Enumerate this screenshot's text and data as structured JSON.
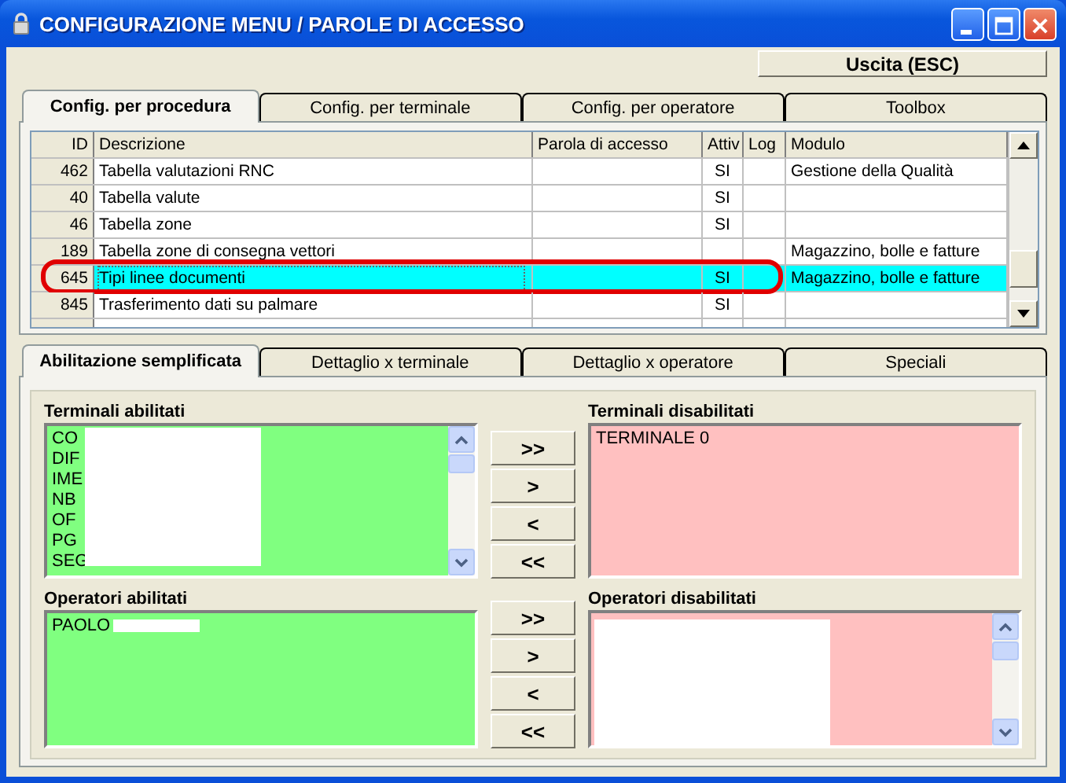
{
  "window": {
    "title": "CONFIGURAZIONE MENU / PAROLE DI ACCESSO"
  },
  "exit_button": "Uscita (ESC)",
  "tabs": [
    {
      "label": "Config. per procedura",
      "selected": true
    },
    {
      "label": "Config. per terminale",
      "selected": false
    },
    {
      "label": "Config. per operatore",
      "selected": false
    },
    {
      "label": "Toolbox",
      "selected": false
    }
  ],
  "table": {
    "columns": [
      "ID",
      "Descrizione",
      "Parola di accesso",
      "Attiv",
      "Log",
      "Modulo"
    ],
    "rows": [
      {
        "id": "462",
        "descrizione": "Tabella valutazioni RNC",
        "attiv": "SI",
        "modulo": "Gestione della Qualità",
        "selected": false
      },
      {
        "id": "40",
        "descrizione": "Tabella valute",
        "attiv": "SI",
        "selected": false
      },
      {
        "id": "46",
        "descrizione": "Tabella zone",
        "attiv": "SI",
        "selected": false
      },
      {
        "id": "189",
        "descrizione": "Tabella zone di consegna vettori",
        "modulo": "Magazzino, bolle e fatture",
        "selected": false
      },
      {
        "id": "645",
        "descrizione": "Tipi linee documenti",
        "attiv": "SI",
        "modulo": "Magazzino, bolle e fatture",
        "selected": true
      },
      {
        "id": "845",
        "descrizione": "Trasferimento dati su palmare",
        "attiv": "SI",
        "selected": false
      }
    ]
  },
  "sub_tabs": [
    {
      "label": "Abilitazione semplificata",
      "selected": true
    },
    {
      "label": "Dettaglio x terminale",
      "selected": false
    },
    {
      "label": "Dettaglio x operatore",
      "selected": false
    },
    {
      "label": "Speciali",
      "selected": false
    }
  ],
  "sections": [
    {
      "enabled_label": "Terminali abilitati",
      "enabled_items": [
        "CO",
        "DIF",
        "IME",
        "NB",
        "OF",
        "PG",
        "SEG"
      ],
      "enabled_redacted": true,
      "enabled_scroll": true,
      "disabled_label": "Terminali disabilitati",
      "disabled_items": [
        "TERMINALE 0"
      ],
      "buttons": [
        ">>",
        ">",
        "<",
        "<<"
      ]
    },
    {
      "enabled_label": "Operatori abilitati",
      "enabled_items": [
        "PAOLO"
      ],
      "enabled_redacted": true,
      "disabled_label": "Operatori disabilitati",
      "disabled_redacted": true,
      "disabled_scroll": true,
      "buttons": [
        ">>",
        ">",
        "<",
        "<<"
      ]
    }
  ]
}
